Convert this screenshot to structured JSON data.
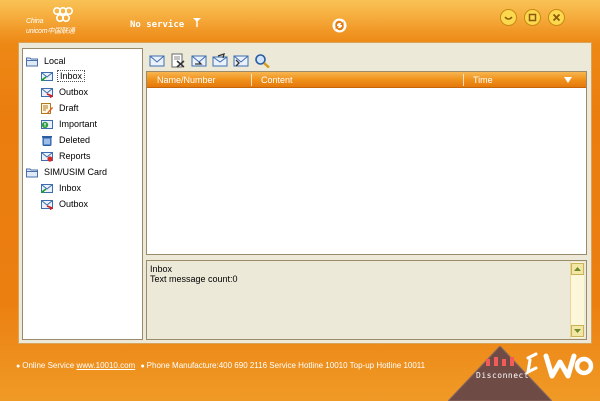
{
  "app": {
    "brand_line1": "China",
    "brand_line2": "unicom中国联通",
    "status": "No service",
    "accent": "#ee8a16"
  },
  "tree": {
    "local_label": "Local",
    "local_items": [
      {
        "label": "Inbox",
        "icon": "inbox-icon",
        "selected": true
      },
      {
        "label": "Outbox",
        "icon": "outbox-icon"
      },
      {
        "label": "Draft",
        "icon": "draft-icon"
      },
      {
        "label": "Important",
        "icon": "important-icon"
      },
      {
        "label": "Deleted",
        "icon": "trash-icon"
      },
      {
        "label": "Reports",
        "icon": "report-icon"
      }
    ],
    "sim_label": "SIM/USIM Card",
    "sim_items": [
      {
        "label": "Inbox",
        "icon": "inbox-icon"
      },
      {
        "label": "Outbox",
        "icon": "outbox-icon"
      }
    ]
  },
  "toolbar": [
    "new-message-icon",
    "delete-message-icon",
    "reply-icon",
    "forward-icon",
    "move-icon",
    "search-icon"
  ],
  "list": {
    "columns": [
      "Name/Number",
      "Content",
      "Time"
    ]
  },
  "detail": {
    "folder": "Inbox",
    "count_text": "Text message count:0"
  },
  "footer": {
    "online_service_label": "Online Service",
    "online_service_link": "www.10010.com",
    "info": "Phone Manufacture:400 690 2116 Service Hotline 10010 Top-up Hotline 10011",
    "disconnect_label": "Disconnect"
  }
}
